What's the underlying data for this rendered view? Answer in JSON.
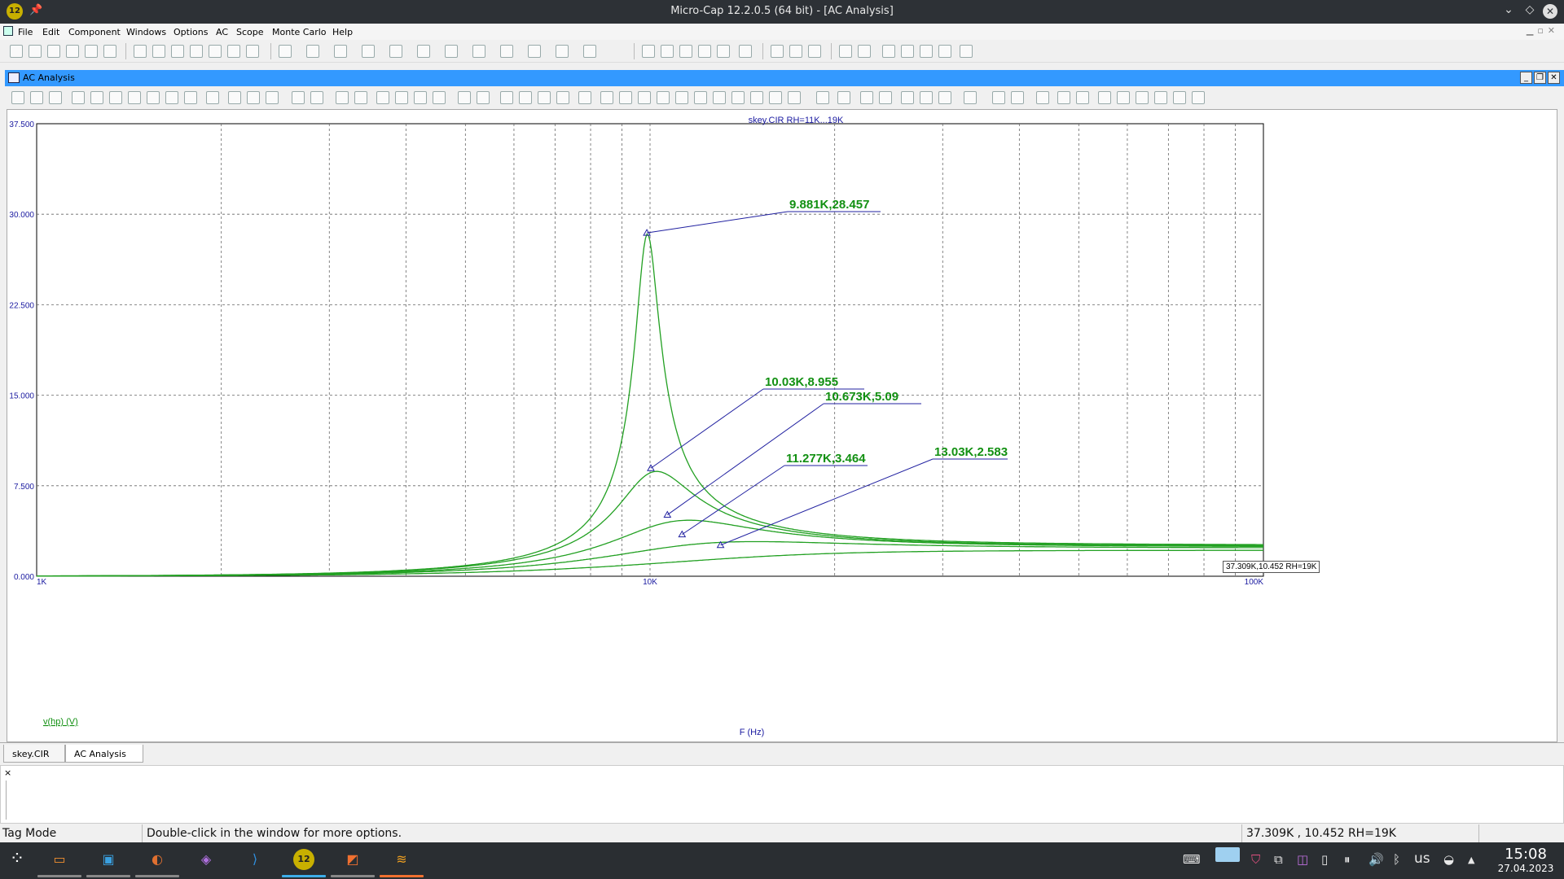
{
  "window": {
    "title": "Micro-Cap 12.2.0.5 (64 bit) - [AC Analysis]",
    "app_icon_label": "12"
  },
  "menu": [
    "File",
    "Edit",
    "Component",
    "Windows",
    "Options",
    "AC",
    "Scope",
    "Monte Carlo",
    "Help"
  ],
  "child_window": {
    "title": "AC Analysis"
  },
  "chart_data": {
    "type": "line",
    "title": "skey.CIR RH=11K...19K",
    "xlabel": "F (Hz)",
    "ylabel": "v(hp) (V)",
    "x_scale": "log",
    "xlim": [
      1000,
      100000
    ],
    "ylim": [
      0,
      37.5
    ],
    "x_ticks": [
      "1K",
      "10K",
      "100K"
    ],
    "y_ticks": [
      "37.500",
      "30.000",
      "22.500",
      "15.000",
      "7.500",
      "0.000"
    ],
    "grid": true,
    "series": [
      {
        "peak_x": 9881,
        "peak_y": 28.457,
        "tail_y": 2.6
      },
      {
        "peak_x": 10030,
        "peak_y": 8.955,
        "tail_y": 2.52
      },
      {
        "peak_x": 10673,
        "peak_y": 5.09,
        "tail_y": 2.45
      },
      {
        "peak_x": 11277,
        "peak_y": 3.464,
        "tail_y": 2.35
      },
      {
        "peak_x": 13030,
        "peak_y": 2.583,
        "tail_y": 2.15
      }
    ],
    "peak_labels": [
      "9.881K,28.457",
      "10.03K,8.955",
      "10.673K,5.09",
      "11.277K,3.464",
      "13.03K,2.583"
    ],
    "cursor_tooltip": "37.309K,10.452 RH=19K",
    "colors": {
      "curve": "#22a022",
      "label": "#129012",
      "leader": "#2020a0",
      "axis_text": "#1a1aa0"
    }
  },
  "tabs": [
    "skey.CIR",
    "AC Analysis"
  ],
  "output": {
    "close": "×"
  },
  "status": {
    "mode": "Tag Mode",
    "hint": "Double-click in the window for more options.",
    "cursor": "37.309K , 10.452 RH=19K"
  },
  "taskbar": {
    "keyboard": "us",
    "time": "15:08",
    "date": "27.04.2023",
    "app_label": "12"
  }
}
